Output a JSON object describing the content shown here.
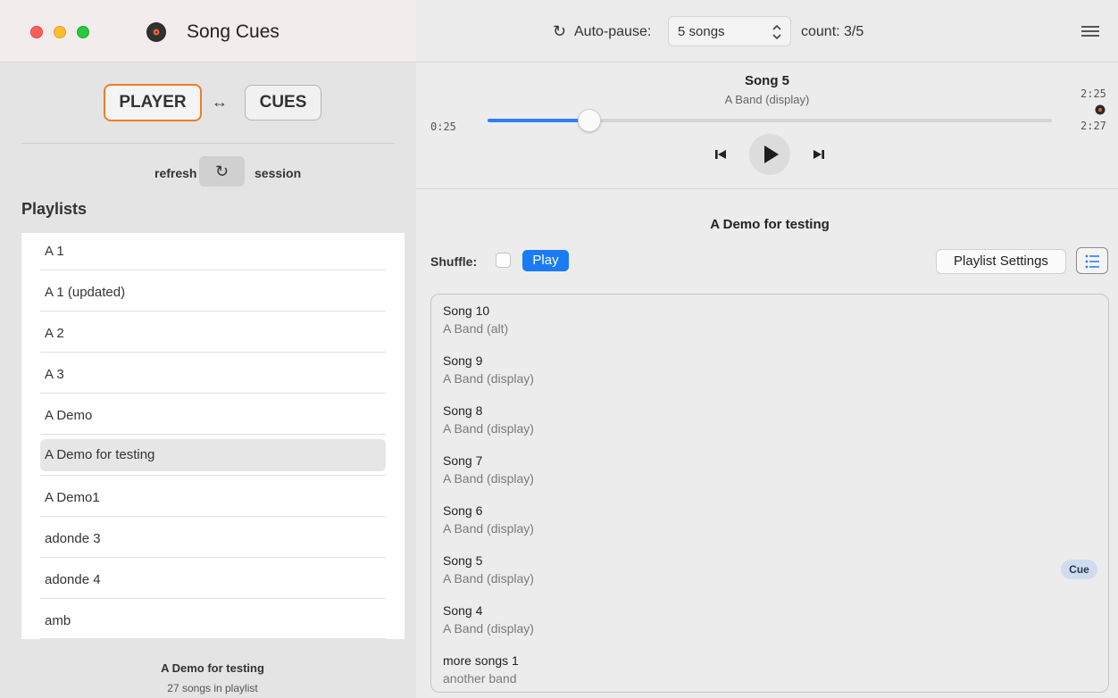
{
  "titlebar": {
    "app_title": "Song Cues",
    "autopause_label": "Auto-pause:",
    "autopause_value": "5 songs",
    "count_label": "count: 3/5"
  },
  "sidebar": {
    "mode_player": "PLAYER",
    "mode_arrow": "↔",
    "mode_cues": "CUES",
    "refresh_label": "refresh",
    "session_label": "session",
    "playlists_heading": "Playlists",
    "playlists": [
      {
        "label": "A 1"
      },
      {
        "label": "A 1 (updated)"
      },
      {
        "label": "A 2"
      },
      {
        "label": "A 3"
      },
      {
        "label": "A Demo"
      },
      {
        "label": "A Demo for testing",
        "selected": true
      },
      {
        "label": "A Demo1"
      },
      {
        "label": "adonde 3"
      },
      {
        "label": "adonde 4"
      },
      {
        "label": "amb"
      }
    ],
    "footer_title": "A Demo for testing",
    "footer_subtitle": "27 songs in playlist"
  },
  "player": {
    "title": "Song 5",
    "artist": "A Band (display)",
    "elapsed": "0:25",
    "time_top": "2:25",
    "time_bottom": "2:27",
    "progress": 0.18
  },
  "detail": {
    "title": "A Demo for testing",
    "shuffle_label": "Shuffle:",
    "shuffle_checked": false,
    "play_label": "Play",
    "settings_label": "Playlist Settings",
    "cue_label": "Cue",
    "songs": [
      {
        "title": "Song 10",
        "artist": "A Band (alt)"
      },
      {
        "title": "Song 9",
        "artist": "A Band (display)"
      },
      {
        "title": "Song 8",
        "artist": "A Band (display)"
      },
      {
        "title": "Song 7",
        "artist": "A Band (display)"
      },
      {
        "title": "Song 6",
        "artist": "A Band (display)"
      },
      {
        "title": "Song 5",
        "artist": "A Band (display)",
        "cue": true
      },
      {
        "title": "Song 4",
        "artist": "A Band (display)"
      },
      {
        "title": "more songs 1",
        "artist": "another band"
      }
    ]
  },
  "colors": {
    "accent": "#1a7cf5",
    "mode_highlight": "#f07b2a",
    "cue_badge": "#cfdcef"
  },
  "icons": {
    "app": "vinyl-record-icon",
    "refresh": "refresh-icon",
    "menu": "hamburger-menu-icon",
    "prev": "skip-back-icon",
    "play": "play-icon",
    "next": "skip-forward-icon",
    "list_toggle": "list-icon"
  }
}
